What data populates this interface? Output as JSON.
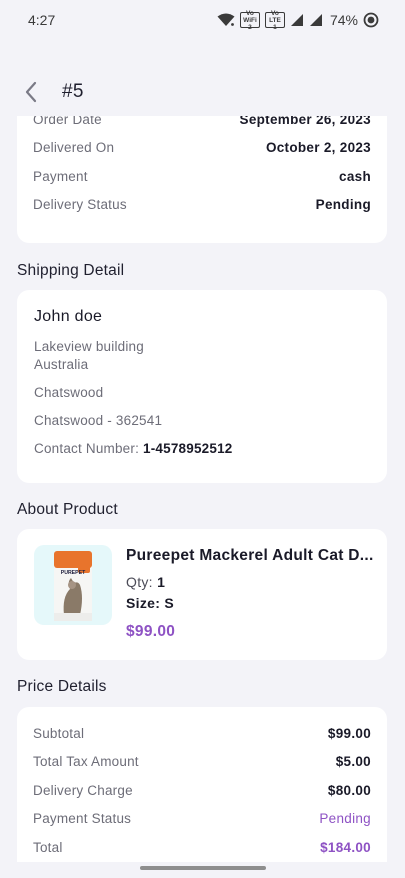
{
  "status_bar": {
    "time": "4:27",
    "volte1_line1": "Vo",
    "volte1_line2": "WiFi 2",
    "volte2_line1": "Vo",
    "volte2_line2": "LTE 1",
    "battery": "74%"
  },
  "header": {
    "title": "#5",
    "back_icon": "chevron-left-icon"
  },
  "order_info": [
    {
      "label": "Order Date",
      "value": "September 26, 2023"
    },
    {
      "label": "Delivered On",
      "value": "October 2, 2023"
    },
    {
      "label": "Payment",
      "value": "cash"
    },
    {
      "label": "Delivery Status",
      "value": "Pending"
    }
  ],
  "shipping": {
    "section_title": "Shipping Detail",
    "name": "John doe",
    "address_line1": "Lakeview building",
    "address_line2": "Australia",
    "city": "Chatswood",
    "city_zip": "Chatswood - 362541",
    "contact_label": "Contact Number: ",
    "contact_value": "1-4578952512"
  },
  "product": {
    "section_title": "About Product",
    "name": "Pureepet Mackerel Adult Cat D...",
    "qty_label": "Qty: ",
    "qty_value": "1",
    "size_label": "Size: ",
    "size_value": "S",
    "price": "$99.00",
    "brand_on_pack": "PUREPET"
  },
  "price_details": {
    "section_title": "Price Details",
    "rows": [
      {
        "label": "Subtotal",
        "value": "$99.00"
      },
      {
        "label": "Total Tax Amount",
        "value": "$5.00"
      },
      {
        "label": "Delivery Charge",
        "value": "$80.00"
      },
      {
        "label": "Payment Status",
        "value": "Pending"
      },
      {
        "label": "Total",
        "value": "$184.00"
      }
    ]
  },
  "colors": {
    "accent": "#8e52c4",
    "background": "#f3f3f8",
    "card": "#ffffff",
    "pack_orange": "#e8742c"
  }
}
